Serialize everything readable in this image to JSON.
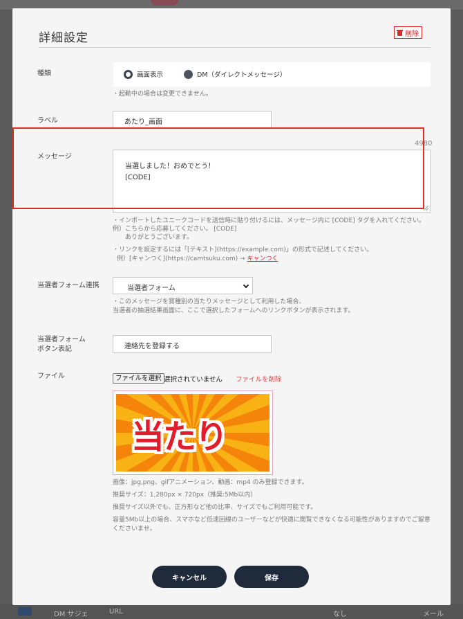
{
  "background": {
    "bottom_row": {
      "col1": "DM サジェ",
      "col2": "URL",
      "col3": "なし",
      "col4": "メール"
    }
  },
  "modal": {
    "title": "詳細設定",
    "delete_label": "削除"
  },
  "type_section": {
    "label": "種類",
    "options": [
      {
        "label": "画面表示",
        "selected": true
      },
      {
        "label": "DM（ダイレクトメッセージ）",
        "selected": false
      }
    ],
    "note": "・起動中の場合は変更できません。"
  },
  "label_section": {
    "label": "ラベル",
    "value": "あたり_画面"
  },
  "message_section": {
    "label": "メッセージ",
    "counter": "4980",
    "line1": "当選しました！おめでとう！",
    "line2": "[CODE]",
    "note1": "・インポートしたユニークコードを送信時に貼り付けるには、メッセージ内に [CODE] タグを入れてください。",
    "note2": "例）こちらから応募してください。 [CODE]",
    "note3": "ありがとうございます。",
    "note4": "・リンクを設定するには「[テキスト](https://example.com)」の形式で記述してください。",
    "note5_prefix": "例）[キャンつく](https://camtsuku.com) → ",
    "note5_link": "キャンつく"
  },
  "form_link_section": {
    "label": "当選者フォーム連携",
    "selected": "当選者フォーム",
    "note1": "・このメッセージを賞種別の当たりメッセージとして利用した場合、",
    "note2": "当選者の抽選結果画面に、ここで選択したフォームへのリンクボタンが表示されます。"
  },
  "button_label_section": {
    "label_line1": "当選者フォーム",
    "label_line2": "ボタン表記",
    "value": "連絡先を登録する"
  },
  "file_section": {
    "label": "ファイル",
    "choose_label": "ファイルを選択",
    "status": "選択されていません",
    "delete_label": "ファイルを削除",
    "preview_text": "当たり",
    "note1": "画像：jpg,png、gifアニメーション、動画：mp4 のみ登録できます。",
    "note2": "推奨サイズ：1,280px × 720px（推奨:5Mb以内）",
    "note3": "推奨サイズ以外でも、正方形など他の比率、サイズでもご利用可能です。",
    "note4": "容量5Mb以上の場合、スマホなど低速回線のユーザーなどが快適に閲覧できなくなる可能性がありますのでご留意",
    "note5": "くださいませ。"
  },
  "actions": {
    "cancel": "キャンセル",
    "save": "保存"
  },
  "colors": {
    "accent_dark": "#1f2a3b",
    "danger": "#d42b2b",
    "highlight": "#e02c1c"
  }
}
